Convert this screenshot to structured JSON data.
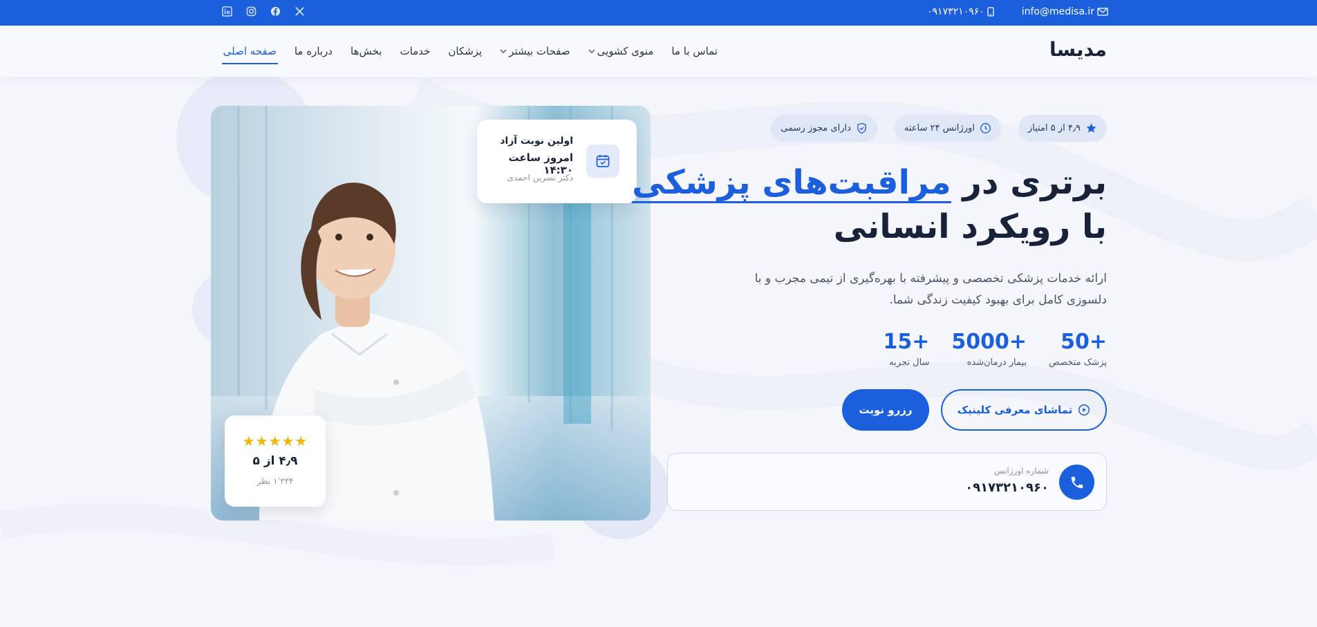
{
  "topbar": {
    "email": "info@medisa.ir",
    "phone": "۰۹۱۷۳۲۱۰۹۶۰",
    "socials": [
      {
        "icon": "linkedin-icon"
      },
      {
        "icon": "instagram-icon"
      },
      {
        "icon": "facebook-icon"
      },
      {
        "icon": "x-icon"
      }
    ]
  },
  "header": {
    "logo": "مدیسا",
    "nav": [
      {
        "label": "صفحه اصلی",
        "active": true,
        "dropdown": false
      },
      {
        "label": "درباره ما",
        "active": false,
        "dropdown": false
      },
      {
        "label": "بخش‌ها",
        "active": false,
        "dropdown": false
      },
      {
        "label": "خدمات",
        "active": false,
        "dropdown": false
      },
      {
        "label": "پزشکان",
        "active": false,
        "dropdown": false
      },
      {
        "label": "صفحات بیشتر",
        "active": false,
        "dropdown": true
      },
      {
        "label": "منوی کشویی",
        "active": false,
        "dropdown": true
      },
      {
        "label": "تماس با ما",
        "active": false,
        "dropdown": false
      }
    ]
  },
  "hero": {
    "badges": [
      {
        "label": "دارای مجوز رسمی",
        "icon": "shield-check-icon"
      },
      {
        "label": "اورژانس ۲۴ ساعته",
        "icon": "clock-icon"
      },
      {
        "label": "۴٫۹ از ۵ امتیاز",
        "icon": "star-icon"
      }
    ],
    "headline_pre": "برتری در ",
    "headline_highlight": "مراقبت‌های پزشکی",
    "headline_line2": "با رویکرد انسانی",
    "description": "ارائه خدمات پزشکی تخصصی و پیشرفته با بهره‌گیری از تیمی مجرب و با دلسوزی کامل برای بهبود کیفیت زندگی شما.",
    "stats": [
      {
        "value": "15+",
        "label": "سال تجربه"
      },
      {
        "value": "5000+",
        "label": "بیمار درمان‌شده"
      },
      {
        "value": "50+",
        "label": "پزشک متخصص"
      }
    ],
    "primary_button": "رزرو نوبت",
    "secondary_button": "تماشای معرفی کلینیک",
    "emergency": {
      "label": "شماره اورژانس",
      "number": "۰۹۱۷۳۲۱۰۹۶۰"
    }
  },
  "appointment_card": {
    "title": "اولین نوبت آزاد",
    "time": "امروز ساعت ۱۴:۳۰",
    "doctor": "دکتر نسرین احمدی"
  },
  "rating_card": {
    "stars": "★★★★★",
    "rating": 4.9,
    "score": "۴٫۹ از ۵",
    "reviews": "۱٬۲۳۴ نظر"
  },
  "colors": {
    "primary": "#1b5fdc",
    "dark": "#18233a",
    "star": "#f5b40a"
  }
}
